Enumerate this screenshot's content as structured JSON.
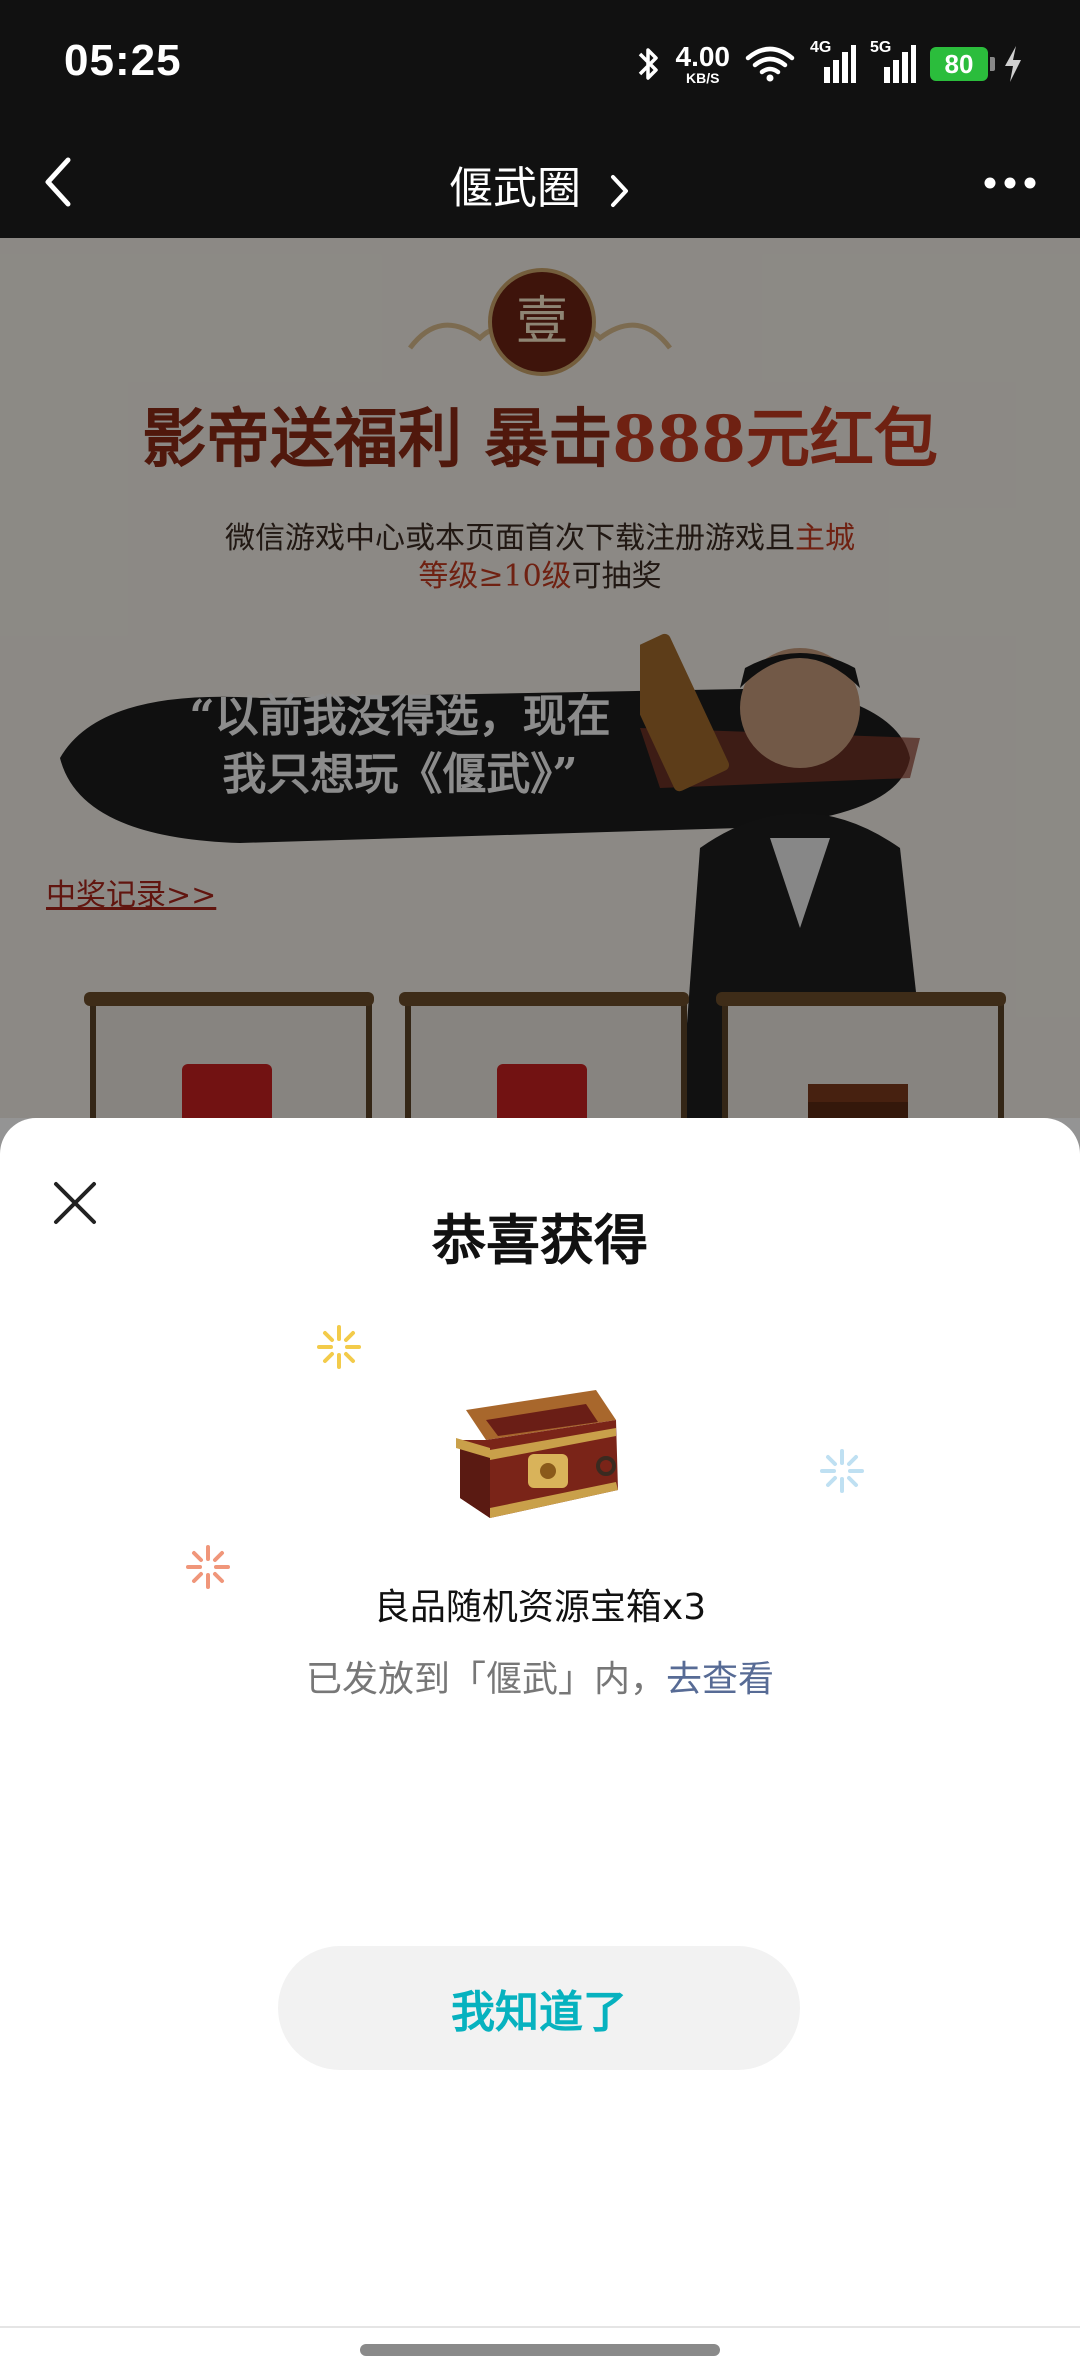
{
  "status_bar": {
    "time": "05:25",
    "net_speed_value": "4.00",
    "net_speed_unit": "KB/S",
    "sim1_label": "4G",
    "sim2_label": "5G",
    "battery": "80"
  },
  "nav": {
    "title": "偃武圈"
  },
  "background_page": {
    "seal_char": "壹",
    "headline_prefix": "影帝送福利 暴击",
    "headline_highlight": "888元红包",
    "subline_part1": "微信游戏中心或本页面首次下载注册游戏且",
    "subline_red1": "主城",
    "subline_red2": "等级≥10级",
    "subline_part2": "可抽奖",
    "quote_line1": "“以前我没得选，现在",
    "quote_line2": "我只想玩《偃武》”",
    "record_link": "中奖记录>>"
  },
  "sheet": {
    "title": "恭喜获得",
    "reward_name": "良品随机资源宝箱x3",
    "reward_note": "已发放到「偃武」内，",
    "reward_note_link": "去查看",
    "ok_button": "我知道了"
  },
  "colors": {
    "accent_teal": "#07b2bf",
    "link_blue": "#576b95",
    "battery_green": "#2bbd3c"
  }
}
